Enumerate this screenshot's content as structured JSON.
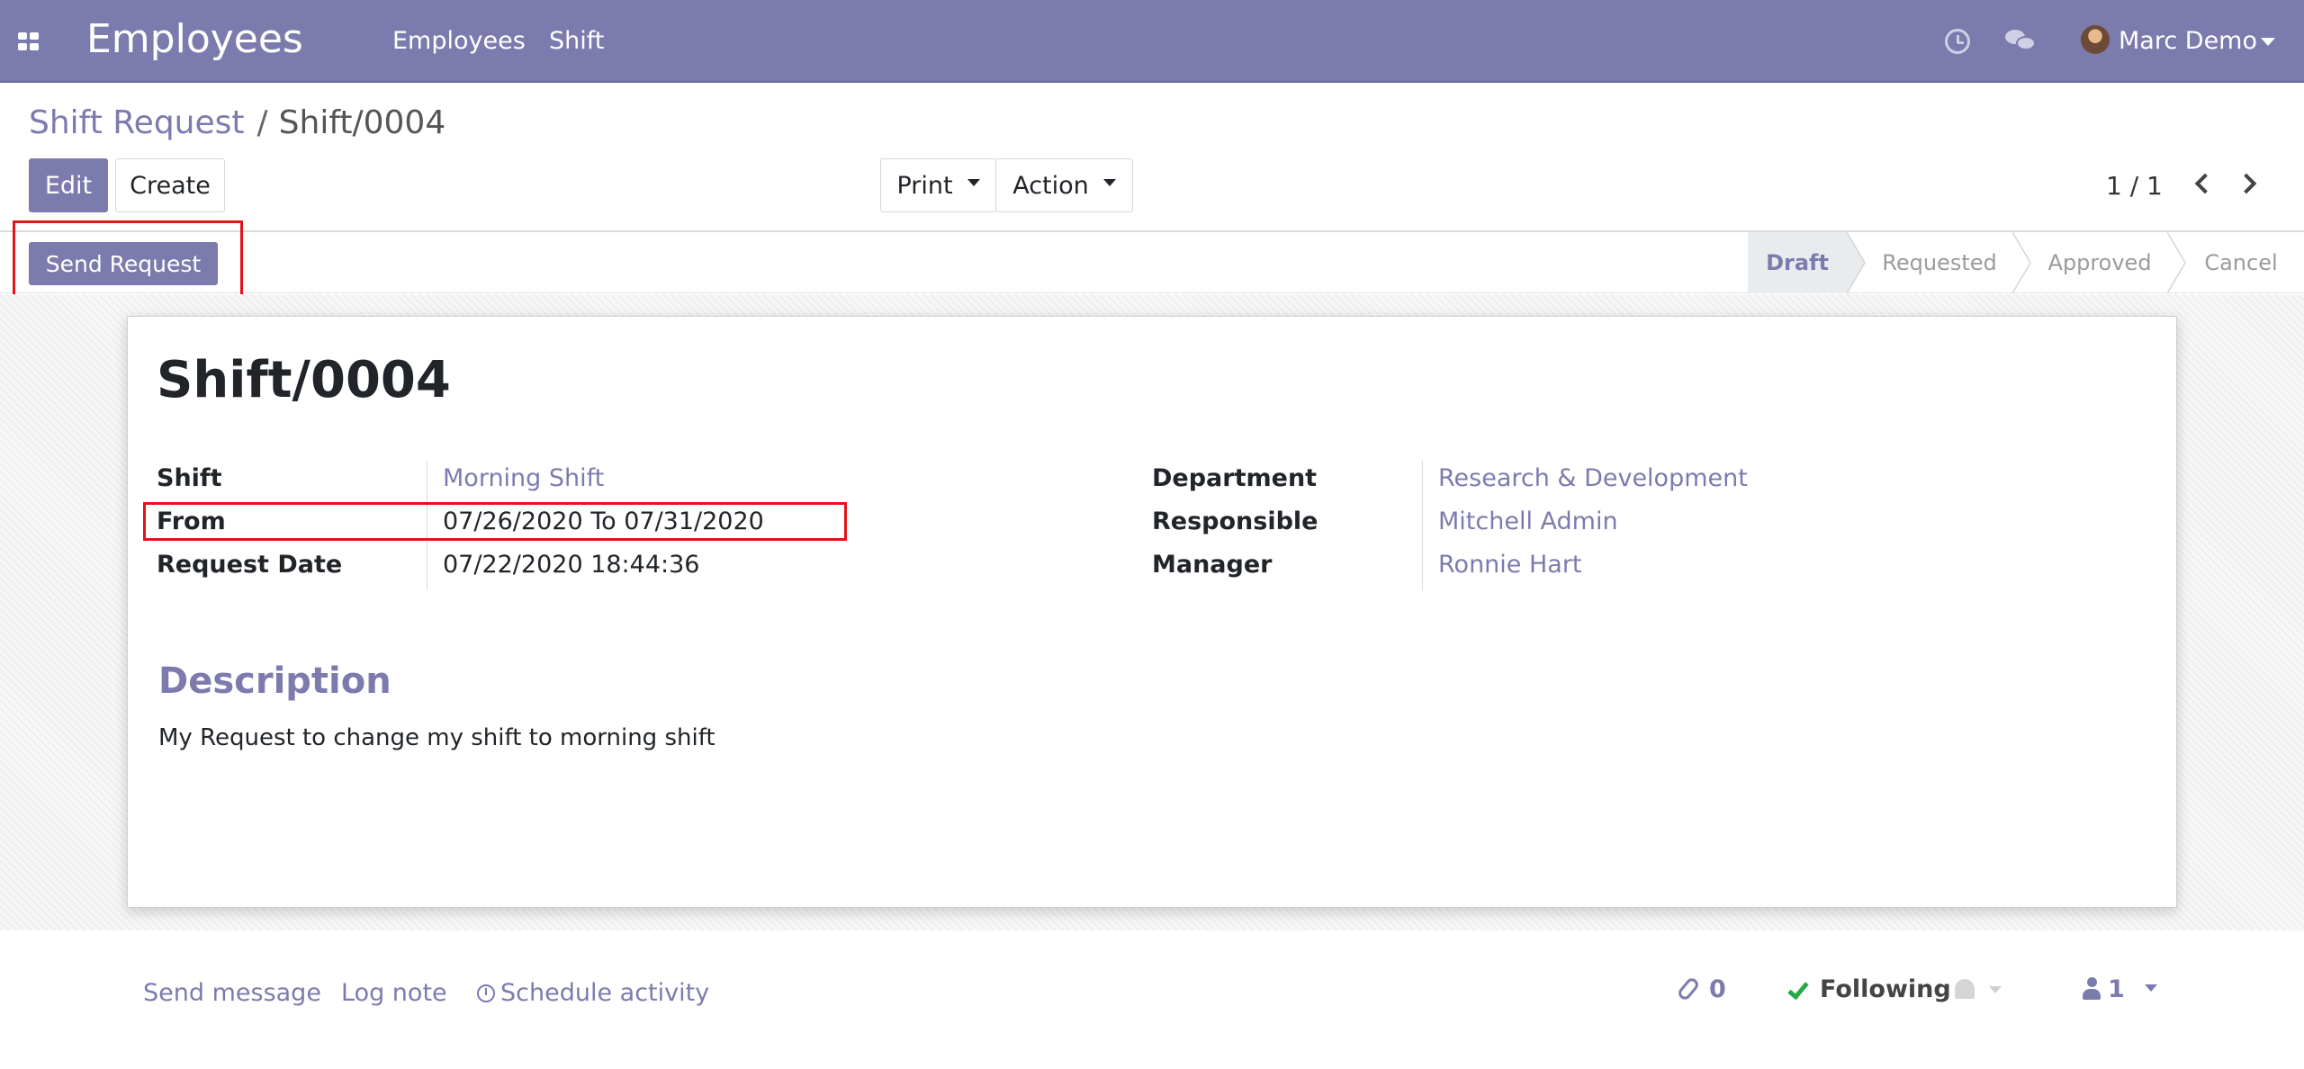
{
  "navbar": {
    "app_title": "Employees",
    "menu": [
      "Employees",
      "Shift"
    ],
    "user_name": "Marc Demo"
  },
  "breadcrumb": {
    "parent": "Shift Request",
    "separator": "/",
    "current": "Shift/0004"
  },
  "toolbar": {
    "edit_label": "Edit",
    "create_label": "Create",
    "print_label": "Print",
    "action_label": "Action",
    "pager": "1 / 1"
  },
  "statusbar": {
    "send_request_label": "Send Request",
    "stages": [
      "Draft",
      "Requested",
      "Approved",
      "Cancel"
    ],
    "active_stage": "Draft"
  },
  "record": {
    "title": "Shift/0004",
    "left_fields": [
      {
        "label": "Shift",
        "value": "Morning Shift"
      },
      {
        "label": "From",
        "value": "07/26/2020 To 07/31/2020"
      },
      {
        "label": "Request Date",
        "value": "07/22/2020 18:44:36"
      }
    ],
    "right_fields": [
      {
        "label": "Department",
        "value": "Research & Development"
      },
      {
        "label": "Responsible",
        "value": "Mitchell Admin"
      },
      {
        "label": "Manager",
        "value": "Ronnie Hart"
      }
    ],
    "description_title": "Description",
    "description": "My Request to change my shift to morning shift"
  },
  "chatter": {
    "send_message": "Send message",
    "log_note": "Log note",
    "schedule_activity": "Schedule activity",
    "attachments_count": "0",
    "following_label": "Following",
    "followers_count": "1"
  },
  "colors": {
    "brand": "#7c7bad",
    "highlight": "#e0151a",
    "following_check": "#28a745"
  }
}
